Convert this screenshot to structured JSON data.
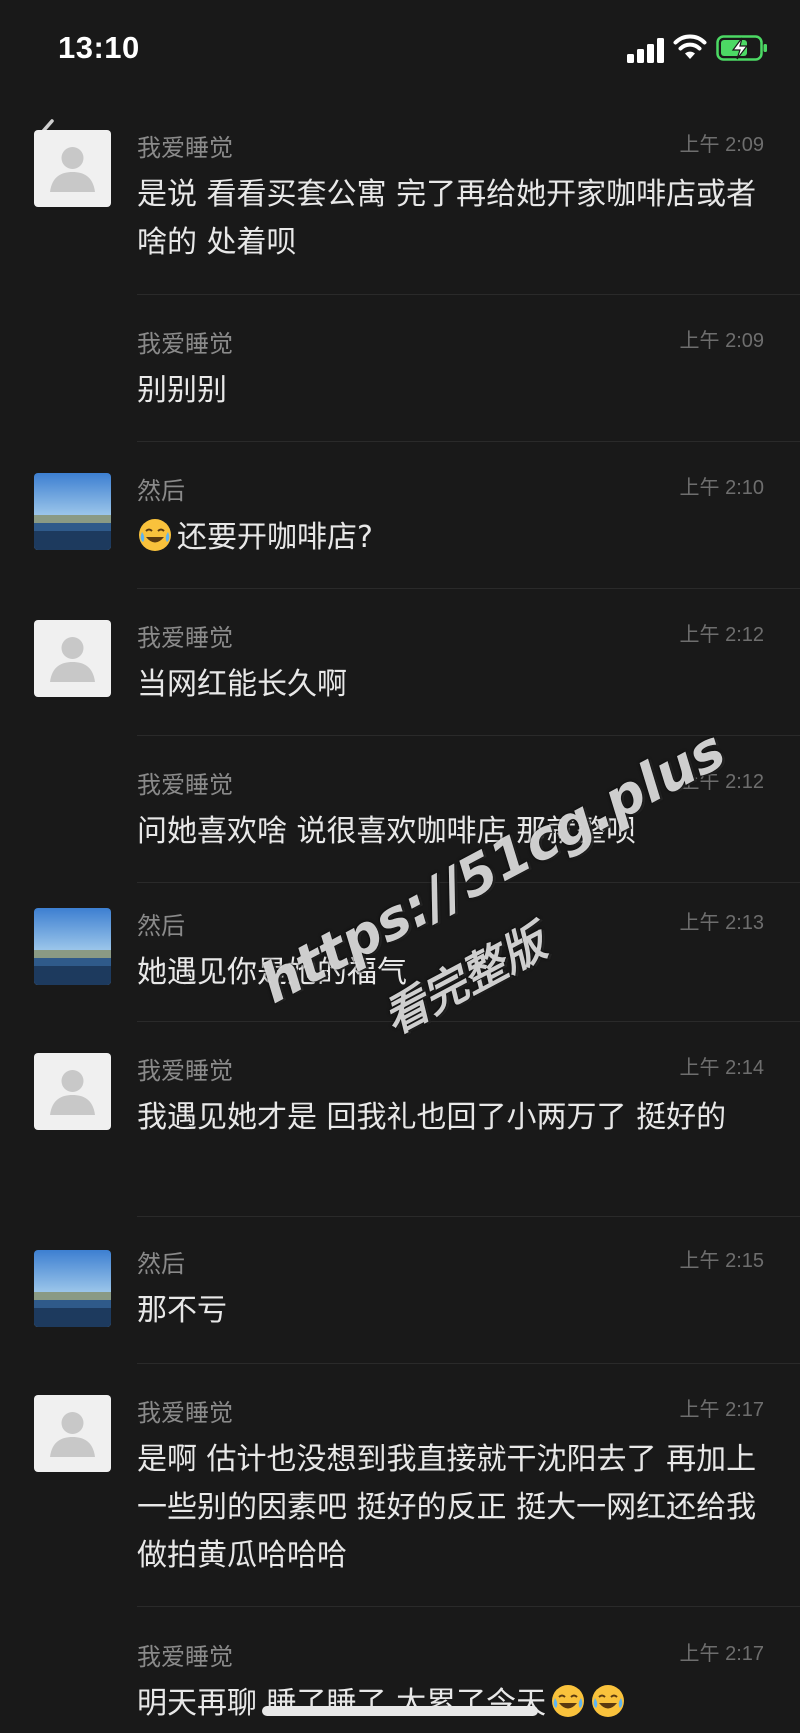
{
  "status_bar": {
    "time": "13:10",
    "signal_icon": "cellular-signal-icon",
    "wifi_icon": "wifi-icon",
    "battery_icon": "battery-charging-icon",
    "battery_color": "#4cd964"
  },
  "nav": {
    "back_icon": "chevron-left-icon"
  },
  "messages": [
    {
      "sender": "我爱睡觉",
      "time": "上午 2:09",
      "text": "是说 看看买套公寓 完了再给她开家咖啡店或者啥的 处着呗",
      "avatar": "default-avatar"
    },
    {
      "sender": "我爱睡觉",
      "time": "上午 2:09",
      "text": "别别别",
      "avatar": ""
    },
    {
      "sender": "然后",
      "time": "上午 2:10",
      "text": "还要开咖啡店?",
      "avatar": "landscape-photo-avatar",
      "emoji": "laughing-crying-emoji"
    },
    {
      "sender": "我爱睡觉",
      "time": "上午 2:12",
      "text": "当网红能长久啊",
      "avatar": "default-avatar"
    },
    {
      "sender": "我爱睡觉",
      "time": "上午 2:12",
      "text": "问她喜欢啥 说很喜欢咖啡店 那就整呗",
      "avatar": ""
    },
    {
      "sender": "然后",
      "time": "上午 2:13",
      "text": "她遇见你是她的福气",
      "avatar": "landscape-photo-avatar"
    },
    {
      "sender": "我爱睡觉",
      "time": "上午 2:14",
      "text": "我遇见她才是 回我礼也回了小两万了 挺好的",
      "avatar": "default-avatar"
    },
    {
      "sender": "然后",
      "time": "上午 2:15",
      "text": "那不亏",
      "avatar": "landscape-photo-avatar"
    },
    {
      "sender": "我爱睡觉",
      "time": "上午 2:17",
      "text": "是啊 估计也没想到我直接就干沈阳去了 再加上一些别的因素吧 挺好的反正 挺大一网红还给我做拍黄瓜哈哈哈",
      "avatar": "default-avatar"
    },
    {
      "sender": "我爱睡觉",
      "time": "上午 2:17",
      "text": "明天再聊 睡了睡了 太累了今天",
      "avatar": "",
      "emoji_after": "laughing-crying-emoji"
    }
  ],
  "watermark": {
    "line1": "https://51cg.plus",
    "line2": "看完整版"
  }
}
